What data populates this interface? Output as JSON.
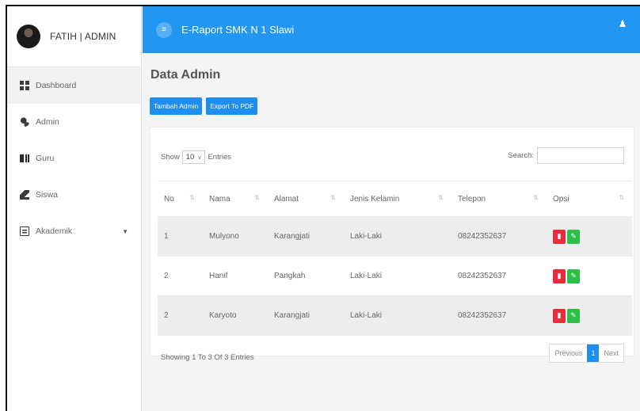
{
  "sidebar": {
    "user_name": "FATIH | ADMIN",
    "items": [
      {
        "label": "Dashboard",
        "icon": "dashboard-icon"
      },
      {
        "label": "Admin",
        "icon": "admin-icon"
      },
      {
        "label": "Guru",
        "icon": "guru-icon"
      },
      {
        "label": "Siswa",
        "icon": "graduation-cap-icon"
      },
      {
        "label": "Akademik",
        "icon": "calendar-icon"
      }
    ]
  },
  "topbar": {
    "title": "E-Raport SMK N 1 Slawi",
    "toggle_icon": "menu-toggle-icon",
    "user_icon": "user-icon",
    "color": "#2196f3"
  },
  "page": {
    "title": "Data Admin",
    "add_button": "Tambah Admin",
    "export_button": "Export To PDF"
  },
  "table_controls": {
    "show_label": "Show",
    "entries_value": "10",
    "entries_label": "Entries",
    "search_label": "Search:"
  },
  "table": {
    "columns": [
      "No",
      "Nama",
      "Alamat",
      "Jenis Kelamin",
      "Telepon",
      "Opsi"
    ],
    "rows": [
      {
        "no": "1",
        "nama": "Mulyono",
        "alamat": "Karangjati",
        "jk": "Laki-Laki",
        "telepon": "08242352637"
      },
      {
        "no": "2",
        "nama": "Hanif",
        "alamat": "Pangkah",
        "jk": "Laki-Laki",
        "telepon": "08242352637"
      },
      {
        "no": "2",
        "nama": "Karyoto",
        "alamat": "Karangjati",
        "jk": "Laki-Laki",
        "telepon": "08242352637"
      }
    ]
  },
  "footer": {
    "info": "Showing 1 To 3 Of 3 Entries",
    "previous": "Previous",
    "current_page": "1",
    "next": "Next"
  },
  "colors": {
    "primary": "#1f8ef1",
    "delete": "#e52d3b",
    "edit": "#2dbf4a"
  }
}
